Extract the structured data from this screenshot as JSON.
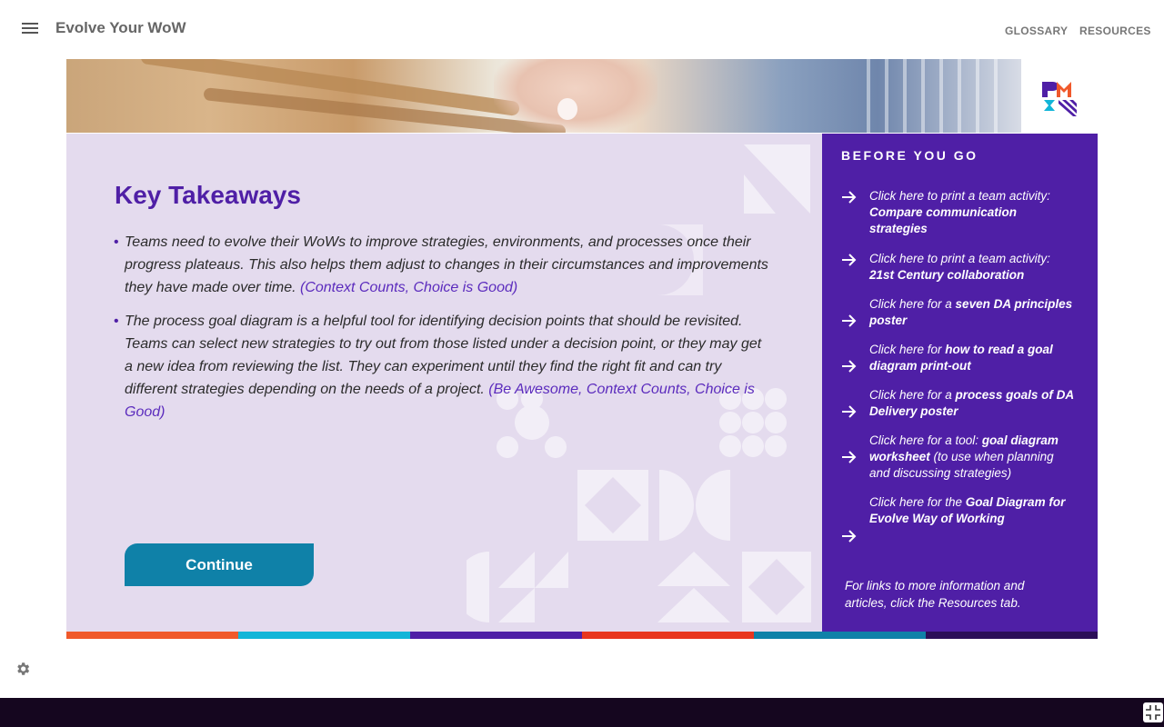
{
  "header": {
    "app_title": "Evolve Your WoW",
    "nav": {
      "glossary": "GLOSSARY",
      "resources": "RESOURCES"
    }
  },
  "main": {
    "heading": "Key Takeaways",
    "bullets": [
      {
        "text": "Teams need to evolve their WoWs to improve strategies, environments, and processes once their progress plateaus. This also helps them adjust to changes in their circumstances and improvements they have made over time. ",
        "ref": "(Context Counts, Choice is Good)"
      },
      {
        "text": "The process goal diagram is a helpful tool for identifying decision points that should be revisited. Teams can select new strategies to try out from those listed under a decision point, or they may get a new idea from reviewing the list. They can experiment until they find the right fit and can try different strategies depending on the needs of a project.          ",
        "ref": "(Be Awesome, Context Counts, Choice is Good)"
      }
    ],
    "continue_label": "Continue"
  },
  "sidebar": {
    "title": "BEFORE YOU GO",
    "links": [
      {
        "pre": "Click here to print a team activity: ",
        "bold": "Compare communication strategies",
        "post": ""
      },
      {
        "pre": "Click here to print a team activity: ",
        "bold": "21st Century collaboration",
        "post": ""
      },
      {
        "pre": "Click here for a ",
        "bold": "seven DA principles poster",
        "post": ""
      },
      {
        "pre": "Click here for ",
        "bold": "how to read a goal diagram print-out",
        "post": ""
      },
      {
        "pre": "Click here for a ",
        "bold": "process goals of DA Delivery poster",
        "post": ""
      },
      {
        "pre": "Click here for a tool: ",
        "bold": "goal diagram worksheet",
        "post": " (to use when planning and discussing strategies)"
      },
      {
        "pre": "Click here for the ",
        "bold": "Goal Diagram for Evolve Way of Working",
        "post": ""
      }
    ],
    "footer": "For links to more information and articles, click the Resources tab."
  },
  "colors": {
    "brand_purple": "#4f1fa6",
    "panel_lavender": "#e4dbee",
    "continue_teal": "#0f81a8",
    "strip": [
      "#f0592b",
      "#12b5d8",
      "#4f1fa6",
      "#e8361f",
      "#0f81a8",
      "#2b0e58"
    ]
  },
  "icons": {
    "menu": "menu-icon",
    "settings": "gear-icon",
    "fullscreen": "exit-fullscreen-icon",
    "arrow": "arrow-right-icon",
    "logo": "pmi-logo"
  }
}
